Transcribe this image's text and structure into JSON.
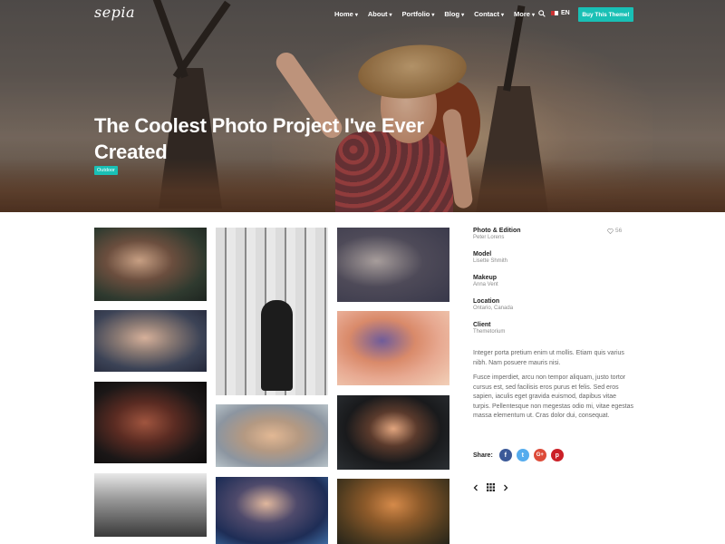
{
  "brand": {
    "logo": "sepia",
    "accent": "#19c0b5"
  },
  "nav": {
    "items": [
      {
        "label": "Home",
        "icon": "chevron-down-icon"
      },
      {
        "label": "About",
        "icon": "chevron-down-icon"
      },
      {
        "label": "Portfolio",
        "icon": "chevron-down-icon"
      },
      {
        "label": "Blog",
        "icon": "chevron-down-icon"
      },
      {
        "label": "Contact",
        "icon": "chevron-down-icon"
      },
      {
        "label": "More",
        "icon": "chevron-down-icon"
      }
    ],
    "search_icon": "search-icon",
    "language": "EN",
    "cta": "Buy This Theme!"
  },
  "hero": {
    "title": "The Coolest Photo Project I've Ever Created",
    "tag": "Outdoor"
  },
  "gallery": {
    "photos": [
      "portrait-wet-hair",
      "portrait-tattoo",
      "portrait-dark",
      "portrait-field-bw",
      "portrait-window-bw",
      "portrait-cat",
      "portrait-beanie",
      "portrait-chair",
      "portrait-sunhat",
      "portrait-black-hat",
      "portrait-sunset-crown"
    ]
  },
  "sidebar": {
    "likes": "56",
    "meta": [
      {
        "label": "Photo & Edition",
        "value": "Peter Lorens"
      },
      {
        "label": "Model",
        "value": "Lisette Shmith"
      },
      {
        "label": "Makeup",
        "value": "Anna Vent"
      },
      {
        "label": "Location",
        "value": "Ontario, Canada"
      },
      {
        "label": "Client",
        "value": "Themetorium"
      }
    ],
    "paragraph_1": "Integer porta pretium enim ut mollis. Etiam quis varius nibh. Nam posuere mauris nisi.",
    "paragraph_2": "Fusce imperdiet, arcu non tempor aliquam, justo tortor cursus est, sed facilisis eros purus et felis. Sed eros sapien, iaculis eget gravida euismod, dapibus vitae turpis. Pellentesque non megestas odio mi, vitae egestas massa elementum ut. Cras dolor dui, consequat.",
    "share_label": "Share:",
    "social": [
      {
        "name": "facebook-icon",
        "glyph": "f",
        "color": "#3b5998"
      },
      {
        "name": "twitter-icon",
        "glyph": "t",
        "color": "#55acee"
      },
      {
        "name": "google-plus-icon",
        "glyph": "G+",
        "color": "#dd4b39"
      },
      {
        "name": "pinterest-icon",
        "glyph": "p",
        "color": "#cb2027"
      }
    ]
  }
}
